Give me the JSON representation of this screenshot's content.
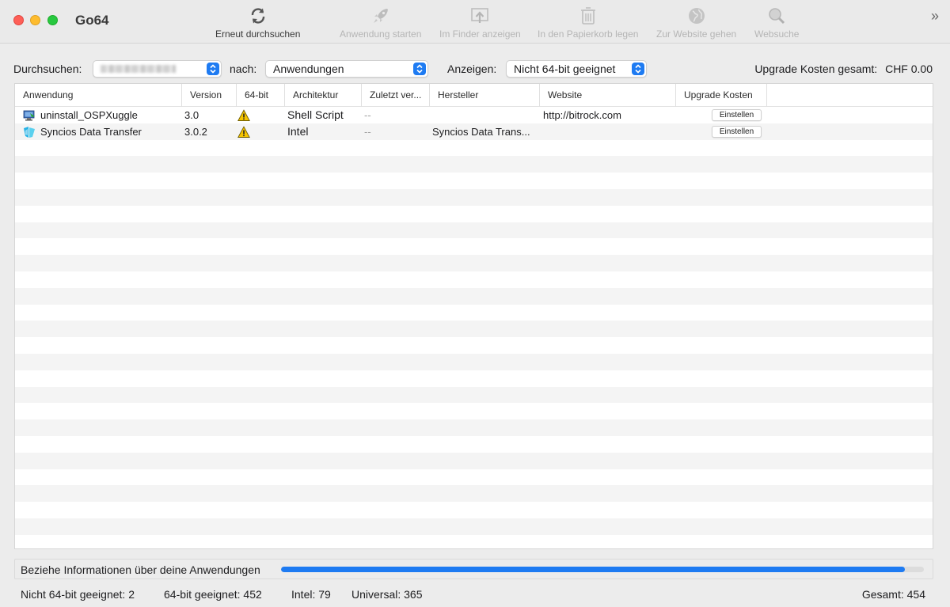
{
  "window": {
    "title": "Go64"
  },
  "toolbar": {
    "rescan": "Erneut durchsuchen",
    "launch": "Anwendung starten",
    "finder": "Im Finder anzeigen",
    "trash": "In den Papierkorb legen",
    "website": "Zur Website gehen",
    "websearch": "Websuche",
    "overflow": "»"
  },
  "filters": {
    "search_label": "Durchsuchen:",
    "search_value": "",
    "for_label": "nach:",
    "for_value": "Anwendungen",
    "show_label": "Anzeigen:",
    "show_value": "Nicht 64-bit geeignet",
    "upgrade_label": "Upgrade Kosten gesamt:",
    "upgrade_value": "CHF 0.00"
  },
  "table": {
    "columns": [
      "Anwendung",
      "Version",
      "64-bit",
      "Architektur",
      "Zuletzt ver...",
      "Hersteller",
      "Website",
      "Upgrade Kosten"
    ],
    "rows": [
      {
        "name": "uninstall_OSPXuggle",
        "icon": "installer-app-icon",
        "version": "3.0",
        "bit64_icon": "warning-icon",
        "architecture": "Shell Script",
        "last_used": "--",
        "vendor": "",
        "website": "http://bitrock.com",
        "upgrade_button": "Einstellen"
      },
      {
        "name": "Syncios Data Transfer",
        "icon": "syncios-app-icon",
        "version": "3.0.2",
        "bit64_icon": "warning-icon",
        "architecture": "Intel",
        "last_used": "--",
        "vendor": "Syncios Data Trans...",
        "website": "",
        "upgrade_button": "Einstellen"
      }
    ]
  },
  "progress": {
    "label": "Beziehe Informationen über deine Anwendungen",
    "fraction": 0.97,
    "color": "#1e7bf2"
  },
  "status": {
    "not64": "Nicht 64-bit geeignet: 2",
    "is64": "64-bit geeignet: 452",
    "intel": "Intel: 79",
    "universal": "Universal: 365",
    "total": "Gesamt: 454"
  },
  "colors": {
    "accent": "#1e7bf2",
    "warning": "#f5c400",
    "traffic_close": "#fe5f57",
    "traffic_min": "#febc2e",
    "traffic_max": "#28c840"
  }
}
